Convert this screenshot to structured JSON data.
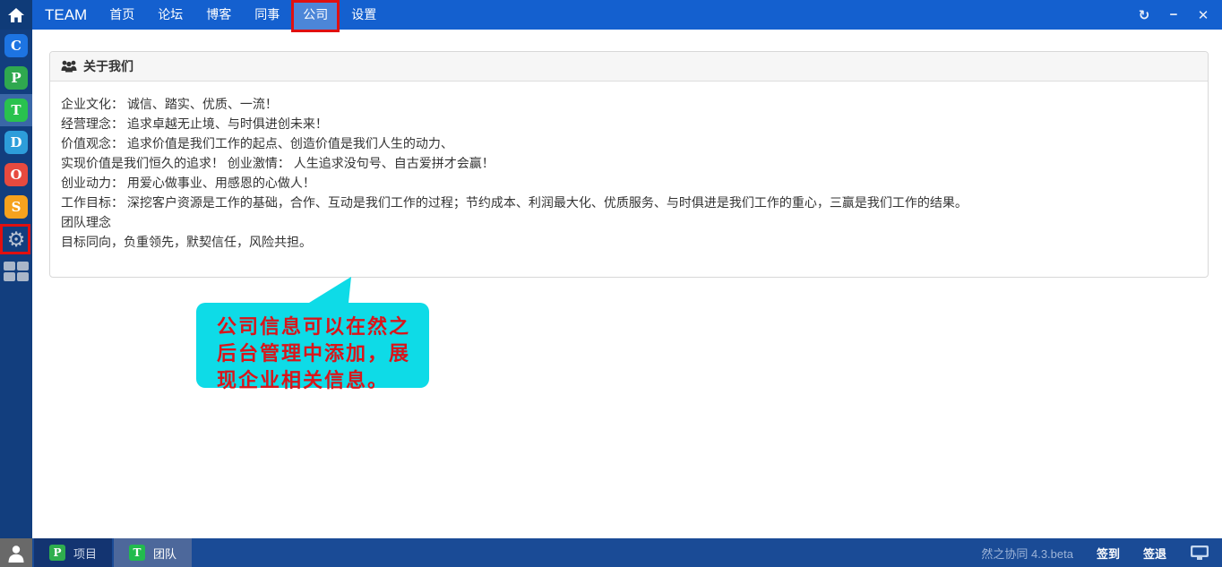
{
  "topbar": {
    "brand": "TEAM",
    "nav": [
      {
        "label": "首页"
      },
      {
        "label": "论坛"
      },
      {
        "label": "博客"
      },
      {
        "label": "同事"
      },
      {
        "label": "公司",
        "active": true,
        "annotated": true
      },
      {
        "label": "设置"
      }
    ],
    "controls": {
      "refresh": "↻",
      "minimize": "−",
      "close": "✕"
    }
  },
  "sidebar": {
    "apps": [
      {
        "letter": "C",
        "color": "#1d74e2"
      },
      {
        "letter": "P",
        "color": "#2fa84f"
      },
      {
        "letter": "T",
        "color": "#29c24e",
        "active": true
      },
      {
        "letter": "D",
        "color": "#2d9dda"
      },
      {
        "letter": "O",
        "color": "#e74a3f"
      },
      {
        "letter": "S",
        "color": "#f6a21d"
      }
    ]
  },
  "panel": {
    "title": "关于我们",
    "lines": [
      "企业文化： 诚信、踏实、优质、一流！",
      "经营理念： 追求卓越无止境、与时俱进创未来！",
      "价值观念： 追求价值是我们工作的起点、创造价值是我们人生的动力、",
      "实现价值是我们恒久的追求！ 创业激情： 人生追求没句号、自古爱拼才会赢！",
      "创业动力： 用爱心做事业、用感恩的心做人！",
      "工作目标： 深挖客户资源是工作的基础，合作、互动是我们工作的过程；节约成本、利润最大化、优质服务、与时俱进是我们工作的重心，三赢是我们工作的结果。",
      "团队理念",
      "目标同向，负重领先，默契信任，风险共担。"
    ]
  },
  "callout": {
    "lines": [
      "公司信息可以在然之",
      "后台管理中添加，展",
      "现企业相关信息。"
    ]
  },
  "footer": {
    "taskbar": [
      {
        "label": "项目",
        "letter": "P",
        "color": "#2fae4e"
      },
      {
        "label": "团队",
        "letter": "T",
        "color": "#22bb4e",
        "active": true
      }
    ],
    "version": "然之协同 4.3.beta",
    "sign_in": "签到",
    "sign_out": "签退"
  },
  "colors": {
    "topbar": "#1460cf",
    "nav_active_bg": "#4c86d8",
    "sidebar": "#123e7e",
    "footer": "#1a4b96",
    "annotation_red": "#e01010",
    "callout_bg": "#0edbe7",
    "callout_text": "#d9151a"
  }
}
